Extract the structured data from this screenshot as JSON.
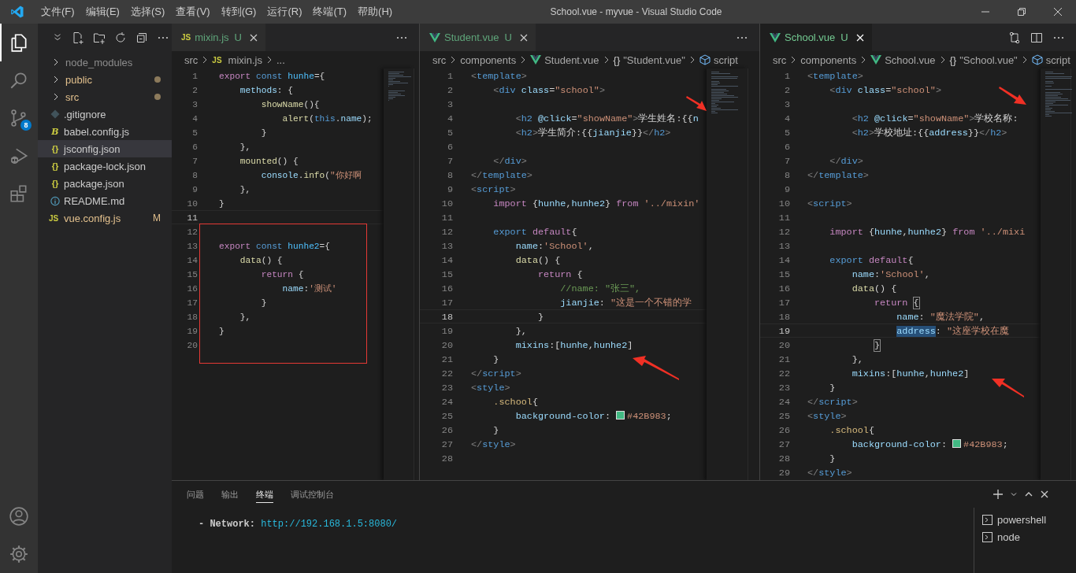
{
  "window": {
    "title": "School.vue - myvue - Visual Studio Code"
  },
  "menu": [
    "文件(F)",
    "编辑(E)",
    "选择(S)",
    "查看(V)",
    "转到(G)",
    "运行(R)",
    "终端(T)",
    "帮助(H)"
  ],
  "activity_bar": {
    "scm_badge": "8"
  },
  "explorer": [
    {
      "name": "node_modules",
      "kind": "folder",
      "ignored": true,
      "modified": false,
      "selected": false
    },
    {
      "name": "public",
      "kind": "folder",
      "ignored": false,
      "modified": true,
      "selected": false
    },
    {
      "name": "src",
      "kind": "folder",
      "ignored": false,
      "modified": true,
      "selected": false
    },
    {
      "name": ".gitignore",
      "kind": "git",
      "ignored": false,
      "modified": false,
      "selected": false
    },
    {
      "name": "babel.config.js",
      "kind": "babel",
      "glyph": "B",
      "ignored": false,
      "modified": false,
      "selected": false
    },
    {
      "name": "jsconfig.json",
      "kind": "json",
      "glyph": "{}",
      "ignored": false,
      "modified": false,
      "selected": true
    },
    {
      "name": "package-lock.json",
      "kind": "json",
      "glyph": "{}",
      "ignored": false,
      "modified": false,
      "selected": false
    },
    {
      "name": "package.json",
      "kind": "json",
      "glyph": "{}",
      "ignored": false,
      "modified": false,
      "selected": false
    },
    {
      "name": "README.md",
      "kind": "info",
      "ignored": false,
      "modified": false,
      "selected": false
    },
    {
      "name": "vue.config.js",
      "kind": "js",
      "glyph": "JS",
      "ignored": false,
      "modified": true,
      "badge": "M",
      "selected": false
    }
  ],
  "editors": [
    {
      "tab": {
        "kind": "js",
        "glyph": "JS",
        "label": "mixin.js",
        "status": "U",
        "selected": false
      },
      "actions": [
        {
          "kind": "more"
        }
      ],
      "breadcrumbs": [
        {
          "label": "src"
        },
        {
          "kind": "js",
          "glyph": "JS",
          "label": "mixin.js"
        },
        {
          "label": "..."
        }
      ],
      "lines": [
        {
          "n": "1",
          "current": false,
          "t": [
            {
              "kind": "keyword",
              "text": "export "
            },
            {
              "kind": "storage",
              "text": "const "
            },
            {
              "kind": "constant",
              "text": "hunhe"
            },
            {
              "kind": "plain",
              "text": "={"
            }
          ]
        },
        {
          "n": "2",
          "current": false,
          "t": [
            {
              "kind": "variable",
              "text": "    methods"
            },
            {
              "kind": "plain",
              "text": ": {"
            }
          ]
        },
        {
          "n": "3",
          "current": false,
          "t": [
            {
              "kind": "function",
              "text": "        showName"
            },
            {
              "kind": "plain",
              "text": "(){"
            }
          ]
        },
        {
          "n": "4",
          "current": false,
          "t": [
            {
              "kind": "function",
              "text": "            alert"
            },
            {
              "kind": "plain",
              "text": "("
            },
            {
              "kind": "storage",
              "text": "this"
            },
            {
              "kind": "plain",
              "text": "."
            },
            {
              "kind": "variable",
              "text": "name"
            },
            {
              "kind": "plain",
              "text": ");"
            }
          ]
        },
        {
          "n": "5",
          "current": false,
          "t": [
            {
              "kind": "plain",
              "text": "        }"
            }
          ]
        },
        {
          "n": "6",
          "current": false,
          "t": [
            {
              "kind": "plain",
              "text": "    },"
            }
          ]
        },
        {
          "n": "7",
          "current": false,
          "t": [
            {
              "kind": "function",
              "text": "    mounted"
            },
            {
              "kind": "plain",
              "text": "() {"
            }
          ]
        },
        {
          "n": "8",
          "current": false,
          "t": [
            {
              "kind": "variable",
              "text": "        console"
            },
            {
              "kind": "plain",
              "text": "."
            },
            {
              "kind": "function",
              "text": "info"
            },
            {
              "kind": "plain",
              "text": "("
            },
            {
              "kind": "string",
              "text": "\"你好啊"
            }
          ]
        },
        {
          "n": "9",
          "current": false,
          "t": [
            {
              "kind": "plain",
              "text": "    },"
            }
          ]
        },
        {
          "n": "10",
          "current": false,
          "t": [
            {
              "kind": "plain",
              "text": "}"
            }
          ]
        },
        {
          "n": "11",
          "current": true
        },
        {
          "n": "12",
          "current": false
        },
        {
          "n": "13",
          "current": false,
          "t": [
            {
              "kind": "keyword",
              "text": "export "
            },
            {
              "kind": "storage",
              "text": "const "
            },
            {
              "kind": "constant",
              "text": "hunhe2"
            },
            {
              "kind": "plain",
              "text": "={"
            }
          ]
        },
        {
          "n": "14",
          "current": false,
          "t": [
            {
              "kind": "function",
              "text": "    data"
            },
            {
              "kind": "plain",
              "text": "() {"
            }
          ]
        },
        {
          "n": "15",
          "current": false,
          "t": [
            {
              "kind": "keyword",
              "text": "        return"
            },
            {
              "kind": "plain",
              "text": " {"
            }
          ]
        },
        {
          "n": "16",
          "current": false,
          "t": [
            {
              "kind": "variable",
              "text": "            name"
            },
            {
              "kind": "plain",
              "text": ":"
            },
            {
              "kind": "string",
              "text": "'测试'"
            }
          ]
        },
        {
          "n": "17",
          "current": false,
          "t": [
            {
              "kind": "plain",
              "text": "        }"
            }
          ]
        },
        {
          "n": "18",
          "current": false,
          "t": [
            {
              "kind": "plain",
              "text": "    },"
            }
          ]
        },
        {
          "n": "19",
          "current": false,
          "t": [
            {
              "kind": "plain",
              "text": "}"
            }
          ]
        },
        {
          "n": "20",
          "current": false
        }
      ]
    },
    {
      "tab": {
        "kind": "vue",
        "label": "Student.vue",
        "status": "U",
        "selected": false
      },
      "actions": [
        {
          "kind": "more"
        }
      ],
      "breadcrumbs": [
        {
          "label": "src"
        },
        {
          "label": "components"
        },
        {
          "kind": "vue",
          "label": "Student.vue"
        },
        {
          "glyph": "{}",
          "label": "\"Student.vue\""
        },
        {
          "kind": "cube",
          "label": "script"
        }
      ],
      "lines": [
        {
          "n": "1",
          "current": false,
          "t": [
            {
              "kind": "bracket",
              "text": "<"
            },
            {
              "kind": "storage",
              "text": "template"
            },
            {
              "kind": "bracket",
              "text": ">"
            }
          ]
        },
        {
          "n": "2",
          "current": false,
          "t": [
            {
              "kind": "bracket",
              "text": "    <"
            },
            {
              "kind": "storage",
              "text": "div "
            },
            {
              "kind": "variable",
              "text": "class"
            },
            {
              "kind": "plain",
              "text": "="
            },
            {
              "kind": "string",
              "text": "\"school\""
            },
            {
              "kind": "bracket",
              "text": ">"
            }
          ]
        },
        {
          "n": "3",
          "current": false
        },
        {
          "n": "4",
          "current": false,
          "t": [
            {
              "kind": "bracket",
              "text": "        <"
            },
            {
              "kind": "storage",
              "text": "h2 "
            },
            {
              "kind": "variable",
              "text": "@click"
            },
            {
              "kind": "plain",
              "text": "="
            },
            {
              "kind": "string",
              "text": "\"showName\""
            },
            {
              "kind": "bracket",
              "text": ">"
            },
            {
              "kind": "plain",
              "text": "学生姓名:{{"
            },
            {
              "kind": "variable",
              "text": "n"
            }
          ]
        },
        {
          "n": "5",
          "current": false,
          "t": [
            {
              "kind": "bracket",
              "text": "        <"
            },
            {
              "kind": "storage",
              "text": "h2"
            },
            {
              "kind": "bracket",
              "text": ">"
            },
            {
              "kind": "plain",
              "text": "学生简介:{{"
            },
            {
              "kind": "variable",
              "text": "jianjie"
            },
            {
              "kind": "plain",
              "text": "}}"
            },
            {
              "kind": "bracket",
              "text": "</"
            },
            {
              "kind": "storage",
              "text": "h2"
            },
            {
              "kind": "bracket",
              "text": ">"
            }
          ]
        },
        {
          "n": "6",
          "current": false
        },
        {
          "n": "7",
          "current": false,
          "t": [
            {
              "kind": "bracket",
              "text": "    </"
            },
            {
              "kind": "storage",
              "text": "div"
            },
            {
              "kind": "bracket",
              "text": ">"
            }
          ]
        },
        {
          "n": "8",
          "current": false,
          "t": [
            {
              "kind": "bracket",
              "text": "</"
            },
            {
              "kind": "storage",
              "text": "template"
            },
            {
              "kind": "bracket",
              "text": ">"
            }
          ]
        },
        {
          "n": "9",
          "current": false,
          "t": [
            {
              "kind": "bracket",
              "text": "<"
            },
            {
              "kind": "storage",
              "text": "script"
            },
            {
              "kind": "bracket",
              "text": ">"
            }
          ]
        },
        {
          "n": "10",
          "current": false,
          "t": [
            {
              "kind": "keyword",
              "text": "    import"
            },
            {
              "kind": "plain",
              "text": " {"
            },
            {
              "kind": "variable",
              "text": "hunhe"
            },
            {
              "kind": "plain",
              "text": ","
            },
            {
              "kind": "variable",
              "text": "hunhe2"
            },
            {
              "kind": "plain",
              "text": "} "
            },
            {
              "kind": "keyword",
              "text": "from"
            },
            {
              "kind": "string",
              "text": " '../mixin'"
            }
          ]
        },
        {
          "n": "11",
          "current": false
        },
        {
          "n": "12",
          "current": false,
          "t": [
            {
              "kind": "storage",
              "text": "    export "
            },
            {
              "kind": "keyword",
              "text": "default"
            },
            {
              "kind": "plain",
              "text": "{"
            }
          ]
        },
        {
          "n": "13",
          "current": false,
          "t": [
            {
              "kind": "variable",
              "text": "        name"
            },
            {
              "kind": "plain",
              "text": ":"
            },
            {
              "kind": "string",
              "text": "'School'"
            },
            {
              "kind": "plain",
              "text": ","
            }
          ]
        },
        {
          "n": "14",
          "current": false,
          "t": [
            {
              "kind": "function",
              "text": "        data"
            },
            {
              "kind": "plain",
              "text": "() {"
            }
          ]
        },
        {
          "n": "15",
          "current": false,
          "t": [
            {
              "kind": "keyword",
              "text": "            return"
            },
            {
              "kind": "plain",
              "text": " {"
            }
          ]
        },
        {
          "n": "16",
          "current": false,
          "t": [
            {
              "kind": "comment",
              "text": "                //name: \"张三\","
            }
          ]
        },
        {
          "n": "17",
          "current": false,
          "t": [
            {
              "kind": "variable",
              "text": "                jianjie"
            },
            {
              "kind": "plain",
              "text": ": "
            },
            {
              "kind": "string",
              "text": "\"这是一个不错的学"
            }
          ]
        },
        {
          "n": "18",
          "current": true,
          "t": [
            {
              "kind": "plain",
              "text": "            }"
            }
          ]
        },
        {
          "n": "19",
          "current": false,
          "t": [
            {
              "kind": "plain",
              "text": "        },"
            }
          ]
        },
        {
          "n": "20",
          "current": false,
          "t": [
            {
              "kind": "variable",
              "text": "        mixins"
            },
            {
              "kind": "plain",
              "text": ":["
            },
            {
              "kind": "variable",
              "text": "hunhe"
            },
            {
              "kind": "plain",
              "text": ","
            },
            {
              "kind": "variable",
              "text": "hunhe2"
            },
            {
              "kind": "plain",
              "text": "]"
            }
          ]
        },
        {
          "n": "21",
          "current": false,
          "t": [
            {
              "kind": "plain",
              "text": "    }"
            }
          ]
        },
        {
          "n": "22",
          "current": false,
          "t": [
            {
              "kind": "bracket",
              "text": "</"
            },
            {
              "kind": "storage",
              "text": "script"
            },
            {
              "kind": "bracket",
              "text": ">"
            }
          ]
        },
        {
          "n": "23",
          "current": false,
          "t": [
            {
              "kind": "bracket",
              "text": "<"
            },
            {
              "kind": "storage",
              "text": "style"
            },
            {
              "kind": "bracket",
              "text": ">"
            }
          ]
        },
        {
          "n": "24",
          "current": false,
          "t": [
            {
              "kind": "selector",
              "text": "    .school"
            },
            {
              "kind": "plain",
              "text": "{"
            }
          ]
        },
        {
          "n": "25",
          "current": false,
          "t": [
            {
              "kind": "variable",
              "text": "        background-color"
            },
            {
              "kind": "plain",
              "text": ": "
            },
            {
              "kind": "color",
              "text": "#42B983"
            },
            {
              "kind": "plain",
              "text": ";"
            }
          ]
        },
        {
          "n": "26",
          "current": false,
          "t": [
            {
              "kind": "plain",
              "text": "    }"
            }
          ]
        },
        {
          "n": "27",
          "current": false,
          "t": [
            {
              "kind": "bracket",
              "text": "</"
            },
            {
              "kind": "storage",
              "text": "style"
            },
            {
              "kind": "bracket",
              "text": ">"
            }
          ]
        },
        {
          "n": "28",
          "current": false
        }
      ]
    },
    {
      "tab": {
        "kind": "vue",
        "label": "School.vue",
        "status": "U",
        "selected": true
      },
      "actions": [
        {
          "kind": "compare"
        },
        {
          "kind": "split"
        },
        {
          "kind": "more"
        }
      ],
      "breadcrumbs": [
        {
          "label": "src"
        },
        {
          "label": "components"
        },
        {
          "kind": "vue",
          "label": "School.vue"
        },
        {
          "glyph": "{}",
          "label": "\"School.vue\""
        },
        {
          "kind": "cube",
          "label": "script"
        }
      ],
      "lines": [
        {
          "n": "1",
          "current": false,
          "t": [
            {
              "kind": "bracket",
              "text": "<"
            },
            {
              "kind": "storage",
              "text": "template"
            },
            {
              "kind": "bracket",
              "text": ">"
            }
          ]
        },
        {
          "n": "2",
          "current": false,
          "t": [
            {
              "kind": "bracket",
              "text": "    <"
            },
            {
              "kind": "storage",
              "text": "div "
            },
            {
              "kind": "variable",
              "text": "class"
            },
            {
              "kind": "plain",
              "text": "="
            },
            {
              "kind": "string",
              "text": "\"school\""
            },
            {
              "kind": "bracket",
              "text": ">"
            }
          ]
        },
        {
          "n": "3",
          "current": false
        },
        {
          "n": "4",
          "current": false,
          "t": [
            {
              "kind": "bracket",
              "text": "        <"
            },
            {
              "kind": "storage",
              "text": "h2 "
            },
            {
              "kind": "variable",
              "text": "@click"
            },
            {
              "kind": "plain",
              "text": "="
            },
            {
              "kind": "string",
              "text": "\"showName\""
            },
            {
              "kind": "bracket",
              "text": ">"
            },
            {
              "kind": "plain",
              "text": "学校名称:"
            }
          ]
        },
        {
          "n": "5",
          "current": false,
          "t": [
            {
              "kind": "bracket",
              "text": "        <"
            },
            {
              "kind": "storage",
              "text": "h2"
            },
            {
              "kind": "bracket",
              "text": ">"
            },
            {
              "kind": "plain",
              "text": "学校地址:{{"
            },
            {
              "kind": "variable",
              "text": "address"
            },
            {
              "kind": "plain",
              "text": "}}"
            },
            {
              "kind": "bracket",
              "text": "</"
            },
            {
              "kind": "storage",
              "text": "h2"
            },
            {
              "kind": "bracket",
              "text": ">"
            }
          ]
        },
        {
          "n": "6",
          "current": false
        },
        {
          "n": "7",
          "current": false,
          "t": [
            {
              "kind": "bracket",
              "text": "    </"
            },
            {
              "kind": "storage",
              "text": "div"
            },
            {
              "kind": "bracket",
              "text": ">"
            }
          ]
        },
        {
          "n": "8",
          "current": false,
          "t": [
            {
              "kind": "bracket",
              "text": "</"
            },
            {
              "kind": "storage",
              "text": "template"
            },
            {
              "kind": "bracket",
              "text": ">"
            }
          ]
        },
        {
          "n": "9",
          "current": false
        },
        {
          "n": "10",
          "current": false,
          "t": [
            {
              "kind": "bracket",
              "text": "<"
            },
            {
              "kind": "storage",
              "text": "script"
            },
            {
              "kind": "bracket",
              "text": ">"
            }
          ]
        },
        {
          "n": "11",
          "current": false
        },
        {
          "n": "12",
          "current": false,
          "t": [
            {
              "kind": "keyword",
              "text": "    import"
            },
            {
              "kind": "plain",
              "text": " {"
            },
            {
              "kind": "variable",
              "text": "hunhe"
            },
            {
              "kind": "plain",
              "text": ","
            },
            {
              "kind": "variable",
              "text": "hunhe2"
            },
            {
              "kind": "plain",
              "text": "} "
            },
            {
              "kind": "keyword",
              "text": "from"
            },
            {
              "kind": "string",
              "text": " '../mixi"
            }
          ]
        },
        {
          "n": "13",
          "current": false
        },
        {
          "n": "14",
          "current": false,
          "t": [
            {
              "kind": "storage",
              "text": "    export "
            },
            {
              "kind": "keyword",
              "text": "default"
            },
            {
              "kind": "plain",
              "text": "{"
            }
          ]
        },
        {
          "n": "15",
          "current": false,
          "t": [
            {
              "kind": "variable",
              "text": "        name"
            },
            {
              "kind": "plain",
              "text": ":"
            },
            {
              "kind": "string",
              "text": "'School'"
            },
            {
              "kind": "plain",
              "text": ","
            }
          ]
        },
        {
          "n": "16",
          "current": false,
          "t": [
            {
              "kind": "function",
              "text": "        data"
            },
            {
              "kind": "plain",
              "text": "() {"
            }
          ]
        },
        {
          "n": "17",
          "current": false,
          "t": [
            {
              "kind": "keyword",
              "text": "            return "
            },
            {
              "kind": "match",
              "text": "{"
            }
          ]
        },
        {
          "n": "18",
          "current": false,
          "t": [
            {
              "kind": "variable",
              "text": "                name"
            },
            {
              "kind": "plain",
              "text": ": "
            },
            {
              "kind": "string",
              "text": "\"魔法学院\""
            },
            {
              "kind": "plain",
              "text": ","
            }
          ]
        },
        {
          "n": "19",
          "current": true,
          "t": [
            {
              "kind": "selection",
              "text": "                address"
            },
            {
              "kind": "plain",
              "text": ": "
            },
            {
              "kind": "string",
              "text": "\"这座学校在魔"
            }
          ]
        },
        {
          "n": "20",
          "current": false,
          "t": [
            {
              "kind": "match",
              "text": "            }"
            }
          ]
        },
        {
          "n": "21",
          "current": false,
          "t": [
            {
              "kind": "plain",
              "text": "        },"
            }
          ]
        },
        {
          "n": "22",
          "current": false,
          "t": [
            {
              "kind": "variable",
              "text": "        mixins"
            },
            {
              "kind": "plain",
              "text": ":["
            },
            {
              "kind": "variable",
              "text": "hunhe"
            },
            {
              "kind": "plain",
              "text": ","
            },
            {
              "kind": "variable",
              "text": "hunhe2"
            },
            {
              "kind": "plain",
              "text": "]"
            }
          ]
        },
        {
          "n": "23",
          "current": false,
          "t": [
            {
              "kind": "plain",
              "text": "    }"
            }
          ]
        },
        {
          "n": "24",
          "current": false,
          "t": [
            {
              "kind": "bracket",
              "text": "</"
            },
            {
              "kind": "storage",
              "text": "script"
            },
            {
              "kind": "bracket",
              "text": ">"
            }
          ]
        },
        {
          "n": "25",
          "current": false,
          "t": [
            {
              "kind": "bracket",
              "text": "<"
            },
            {
              "kind": "storage",
              "text": "style"
            },
            {
              "kind": "bracket",
              "text": ">"
            }
          ]
        },
        {
          "n": "26",
          "current": false,
          "t": [
            {
              "kind": "selector",
              "text": "    .school"
            },
            {
              "kind": "plain",
              "text": "{"
            }
          ]
        },
        {
          "n": "27",
          "current": false,
          "t": [
            {
              "kind": "variable",
              "text": "        background-color"
            },
            {
              "kind": "plain",
              "text": ": "
            },
            {
              "kind": "color",
              "text": "#42B983"
            },
            {
              "kind": "plain",
              "text": ";"
            }
          ]
        },
        {
          "n": "28",
          "current": false,
          "t": [
            {
              "kind": "plain",
              "text": "    }"
            }
          ]
        },
        {
          "n": "29",
          "current": false,
          "t": [
            {
              "kind": "bracket",
              "text": "</"
            },
            {
              "kind": "storage",
              "text": "style"
            },
            {
              "kind": "bracket",
              "text": ">"
            }
          ]
        }
      ]
    }
  ],
  "panel": {
    "tabs": [
      {
        "label": "问题",
        "selected": false
      },
      {
        "label": "输出",
        "selected": false
      },
      {
        "label": "终端",
        "selected": true
      },
      {
        "label": "调试控制台",
        "selected": false
      }
    ],
    "terminal_line": {
      "text": "- Network: ",
      "link": "http://192.168.1.5:8080/"
    },
    "terminals": [
      {
        "label": "powershell"
      },
      {
        "label": "node"
      }
    ]
  }
}
